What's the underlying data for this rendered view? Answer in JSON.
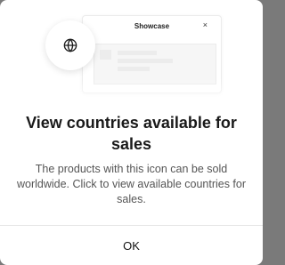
{
  "illustration": {
    "window_title": "Showcase",
    "close_glyph": "×",
    "badge_icon": "globe-icon"
  },
  "dialog": {
    "title": "View countries available for sales",
    "description": "The products with this icon can be sold worldwide. Click to view available countries for sales.",
    "ok_label": "OK"
  }
}
